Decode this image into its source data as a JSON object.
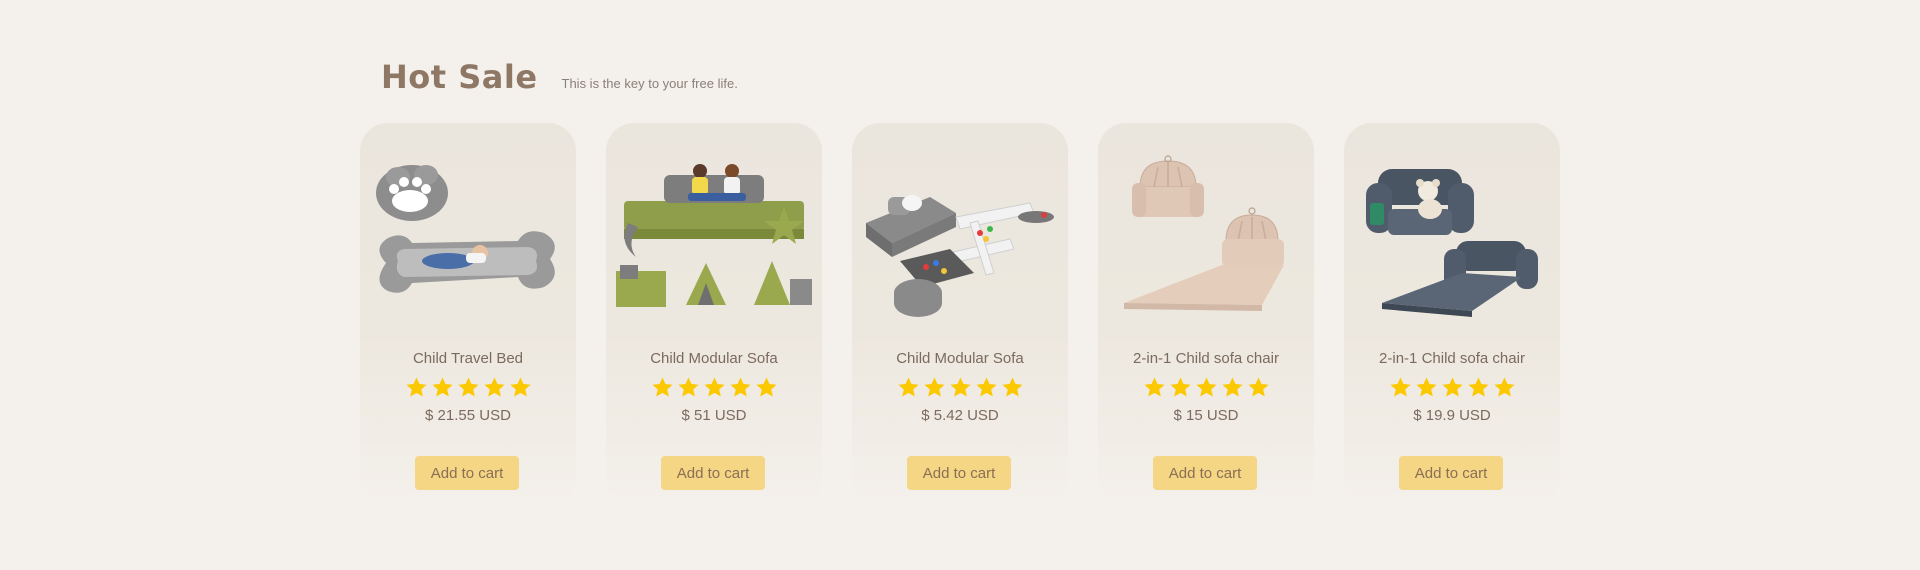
{
  "header": {
    "title": "Hot Sale",
    "subtitle": "This is the key to your free life."
  },
  "colors": {
    "background": "#f4f0eb",
    "card": "#ebe6dd",
    "star": "#fcc800",
    "button": "#f4d685",
    "title": "#8f7766"
  },
  "products": [
    {
      "name": "Child Travel Bed",
      "rating": 5,
      "price": "$ 21.55 USD",
      "button": "Add to cart",
      "image": "gray-paw-travel-bed-image"
    },
    {
      "name": "Child Modular Sofa",
      "rating": 5,
      "price": "$ 51 USD",
      "button": "Add to cart",
      "image": "green-modular-sofa-image"
    },
    {
      "name": "Child Modular Sofa",
      "rating": 5,
      "price": "$ 5.42 USD",
      "button": "Add to cart",
      "image": "gray-modular-sofa-image"
    },
    {
      "name": "2-in-1 Child sofa chair",
      "rating": 5,
      "price": "$ 15 USD",
      "button": "Add to cart",
      "image": "beige-shell-sofa-chair-image"
    },
    {
      "name": "2-in-1 Child sofa chair",
      "rating": 5,
      "price": "$ 19.9 USD",
      "button": "Add to cart",
      "image": "dark-gray-sofa-chair-image"
    }
  ]
}
